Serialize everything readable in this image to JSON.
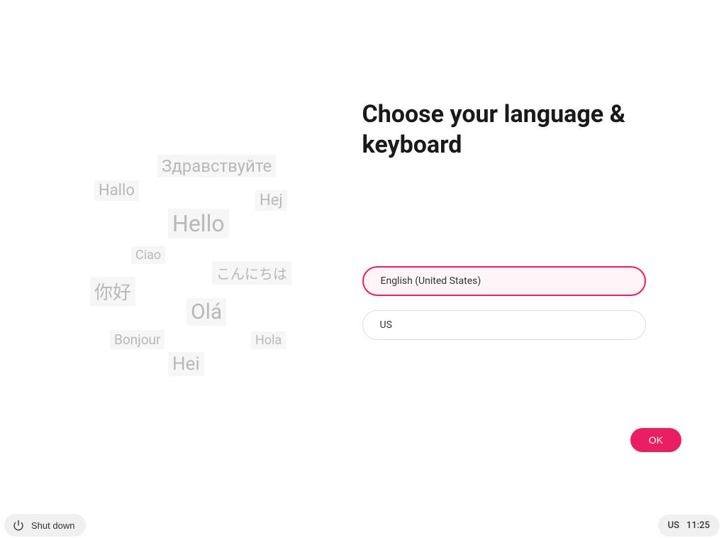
{
  "title": "Choose your language & keyboard",
  "greetings": {
    "g1": "Здравствуйте",
    "g2": "Hallo",
    "g3": "Hej",
    "g4": "Hello",
    "g5": "Ciao",
    "g6": "こんにちは",
    "g7": "你好",
    "g8": "Olá",
    "g9": "Bonjour",
    "g10": "Hola",
    "g11": "Hei"
  },
  "form": {
    "language": "English (United States)",
    "keyboard": "US"
  },
  "buttons": {
    "ok": "OK",
    "shutdown": "Shut down"
  },
  "statusbar": {
    "keyboard_indicator": "US",
    "time": "11:25"
  }
}
